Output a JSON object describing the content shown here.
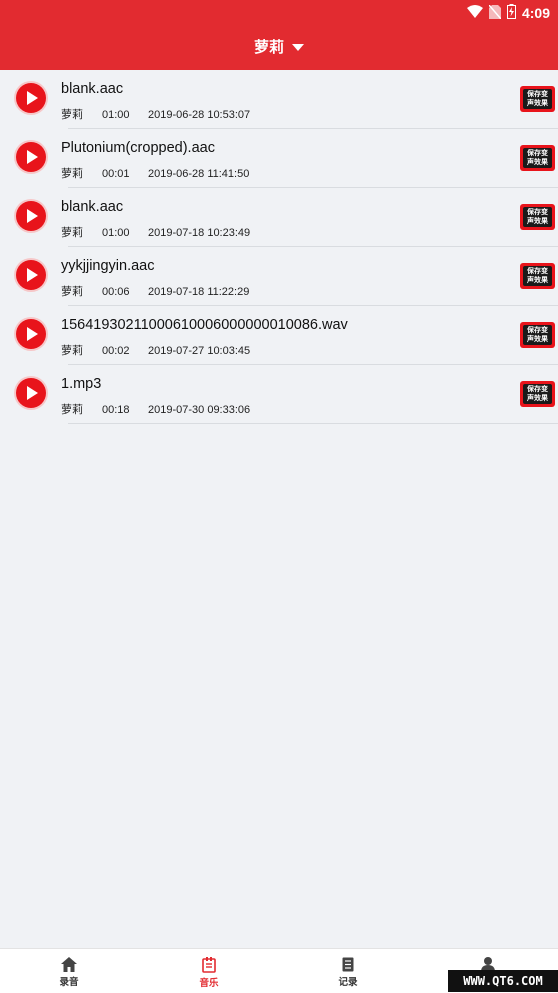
{
  "status_bar": {
    "time": "4:09"
  },
  "header": {
    "title": "萝莉"
  },
  "recordings": [
    {
      "filename": "blank.aac",
      "voice": "萝莉",
      "duration": "01:00",
      "date": "2019-06-28 10:53:07",
      "badge": [
        "保存变",
        "声效果"
      ]
    },
    {
      "filename": "Plutonium(cropped).aac",
      "voice": "萝莉",
      "duration": "00:01",
      "date": "2019-06-28 11:41:50",
      "badge": [
        "保存变",
        "声效果"
      ]
    },
    {
      "filename": "blank.aac",
      "voice": "萝莉",
      "duration": "01:00",
      "date": "2019-07-18 10:23:49",
      "badge": [
        "保存变",
        "声效果"
      ]
    },
    {
      "filename": "yykjjingyin.aac",
      "voice": "萝莉",
      "duration": "00:06",
      "date": "2019-07-18 11:22:29",
      "badge": [
        "保存变",
        "声效果"
      ]
    },
    {
      "filename": "15641930211000610006000000010086.wav",
      "voice": "萝莉",
      "duration": "00:02",
      "date": "2019-07-27 10:03:45",
      "badge": [
        "保存变",
        "声效果"
      ]
    },
    {
      "filename": "1.mp3",
      "voice": "萝莉",
      "duration": "00:18",
      "date": "2019-07-30 09:33:06",
      "badge": [
        "保存变",
        "声效果"
      ]
    }
  ],
  "tabs": [
    {
      "label": "录音",
      "icon": "home-icon"
    },
    {
      "label": "音乐",
      "icon": "music-list-icon"
    },
    {
      "label": "记录",
      "icon": "record-list-icon"
    },
    {
      "label": "",
      "icon": "user-icon"
    }
  ],
  "watermark": "WWW.QT6.COM",
  "colors": {
    "accent": "#e22b30",
    "background": "#f0f2f5"
  }
}
